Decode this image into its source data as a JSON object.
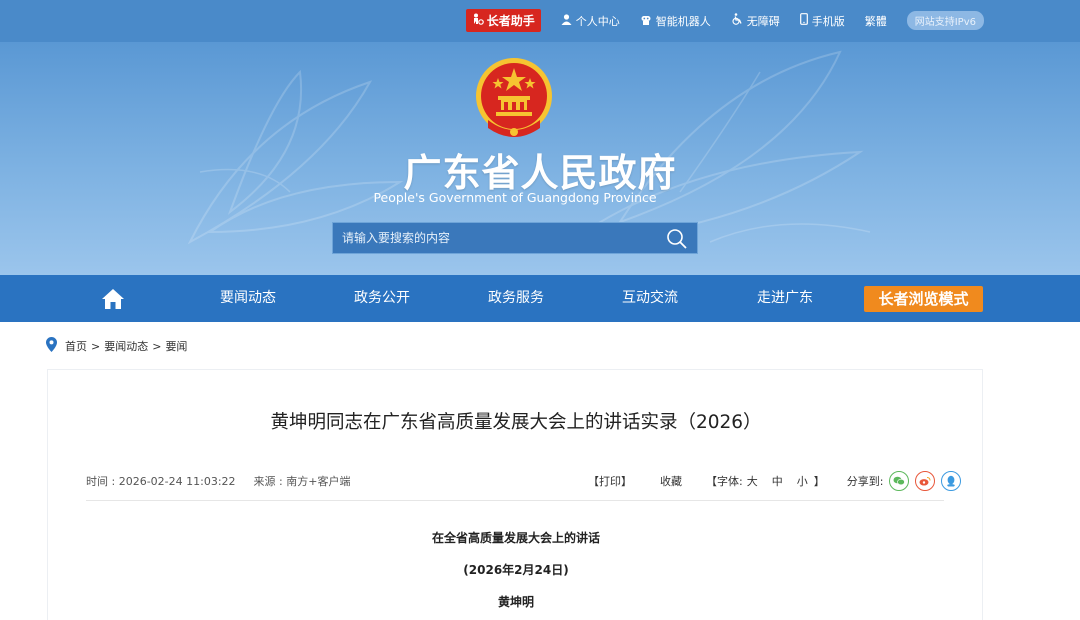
{
  "topbar": {
    "elder_helper": "长者助手",
    "personal_center": "个人中心",
    "smart_robot": "智能机器人",
    "accessibility": "无障碍",
    "mobile": "手机版",
    "traditional": "繁體",
    "ipv6": "网站支持IPv6"
  },
  "header": {
    "title": "广东省人民政府",
    "subtitle": "People's Government of Guangdong Province",
    "search_placeholder": "请输入要搜索的内容"
  },
  "nav": {
    "items": [
      "要闻动态",
      "政务公开",
      "政务服务",
      "互动交流",
      "走进广东"
    ],
    "elder_mode": "长者浏览模式"
  },
  "breadcrumb": {
    "home": "首页",
    "level1": "要闻动态",
    "level2": "要闻",
    "separator": ">"
  },
  "article": {
    "title": "黄坤明同志在广东省高质量发展大会上的讲话实录（2026）",
    "time_label": "时间 : 2026-02-24 11:03:22",
    "source_label": "来源 : 南方+客户端",
    "print": "【打印】",
    "favorite": "收藏",
    "font_label": "【字体:",
    "font_large": "大",
    "font_medium": "中",
    "font_small": "小",
    "font_close": "】",
    "share_label": "分享到:",
    "heading": "在全省高质量发展大会上的讲话",
    "date": "(2026年2月24日)",
    "author": "黄坤明"
  },
  "colors": {
    "topbar": "#4a8ac9",
    "nav": "#2a73c1",
    "elder_red": "#d7261f",
    "elder_orange": "#f08a1e",
    "wechat": "#5cb85c",
    "weibo": "#e8573a",
    "qq": "#3b9ae0"
  }
}
